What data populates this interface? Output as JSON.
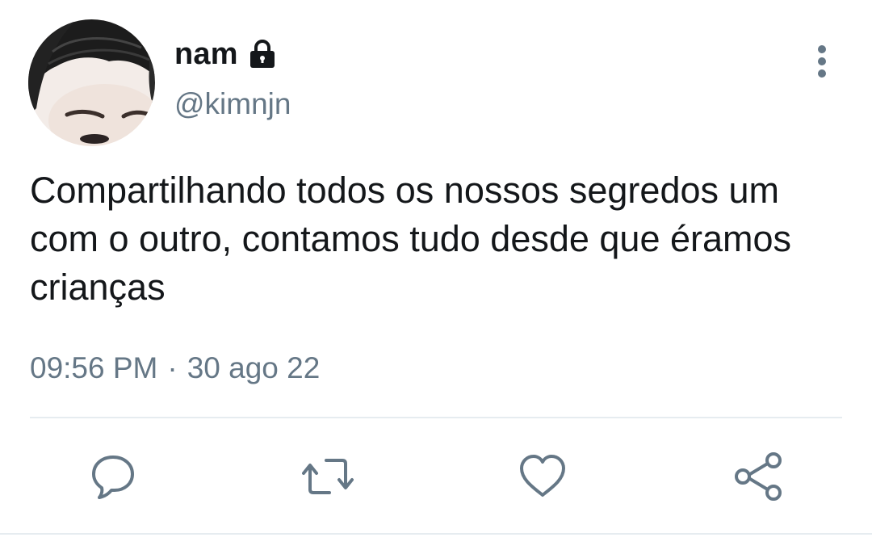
{
  "user": {
    "display_name": "nam",
    "handle": "@kimnjn",
    "avatar_icon": "user-avatar-photo",
    "protected_icon": "lock-icon"
  },
  "tweet": {
    "text": "Compartilhando todos os nossos segredos um com o outro, contamos tudo desde que éramos crianças",
    "time": "09:56 PM",
    "separator": "·",
    "date": "30 ago 22"
  },
  "menu": {
    "more_icon": "vertical-ellipsis-icon"
  },
  "actions": [
    {
      "name": "reply",
      "icon": "speech-bubble-icon"
    },
    {
      "name": "retweet",
      "icon": "retweet-arrows-icon"
    },
    {
      "name": "like",
      "icon": "heart-outline-icon"
    },
    {
      "name": "share",
      "icon": "share-nodes-icon"
    }
  ],
  "colors": {
    "text_primary": "#14171a",
    "text_secondary": "#657786",
    "divider": "#e6ecf0"
  }
}
